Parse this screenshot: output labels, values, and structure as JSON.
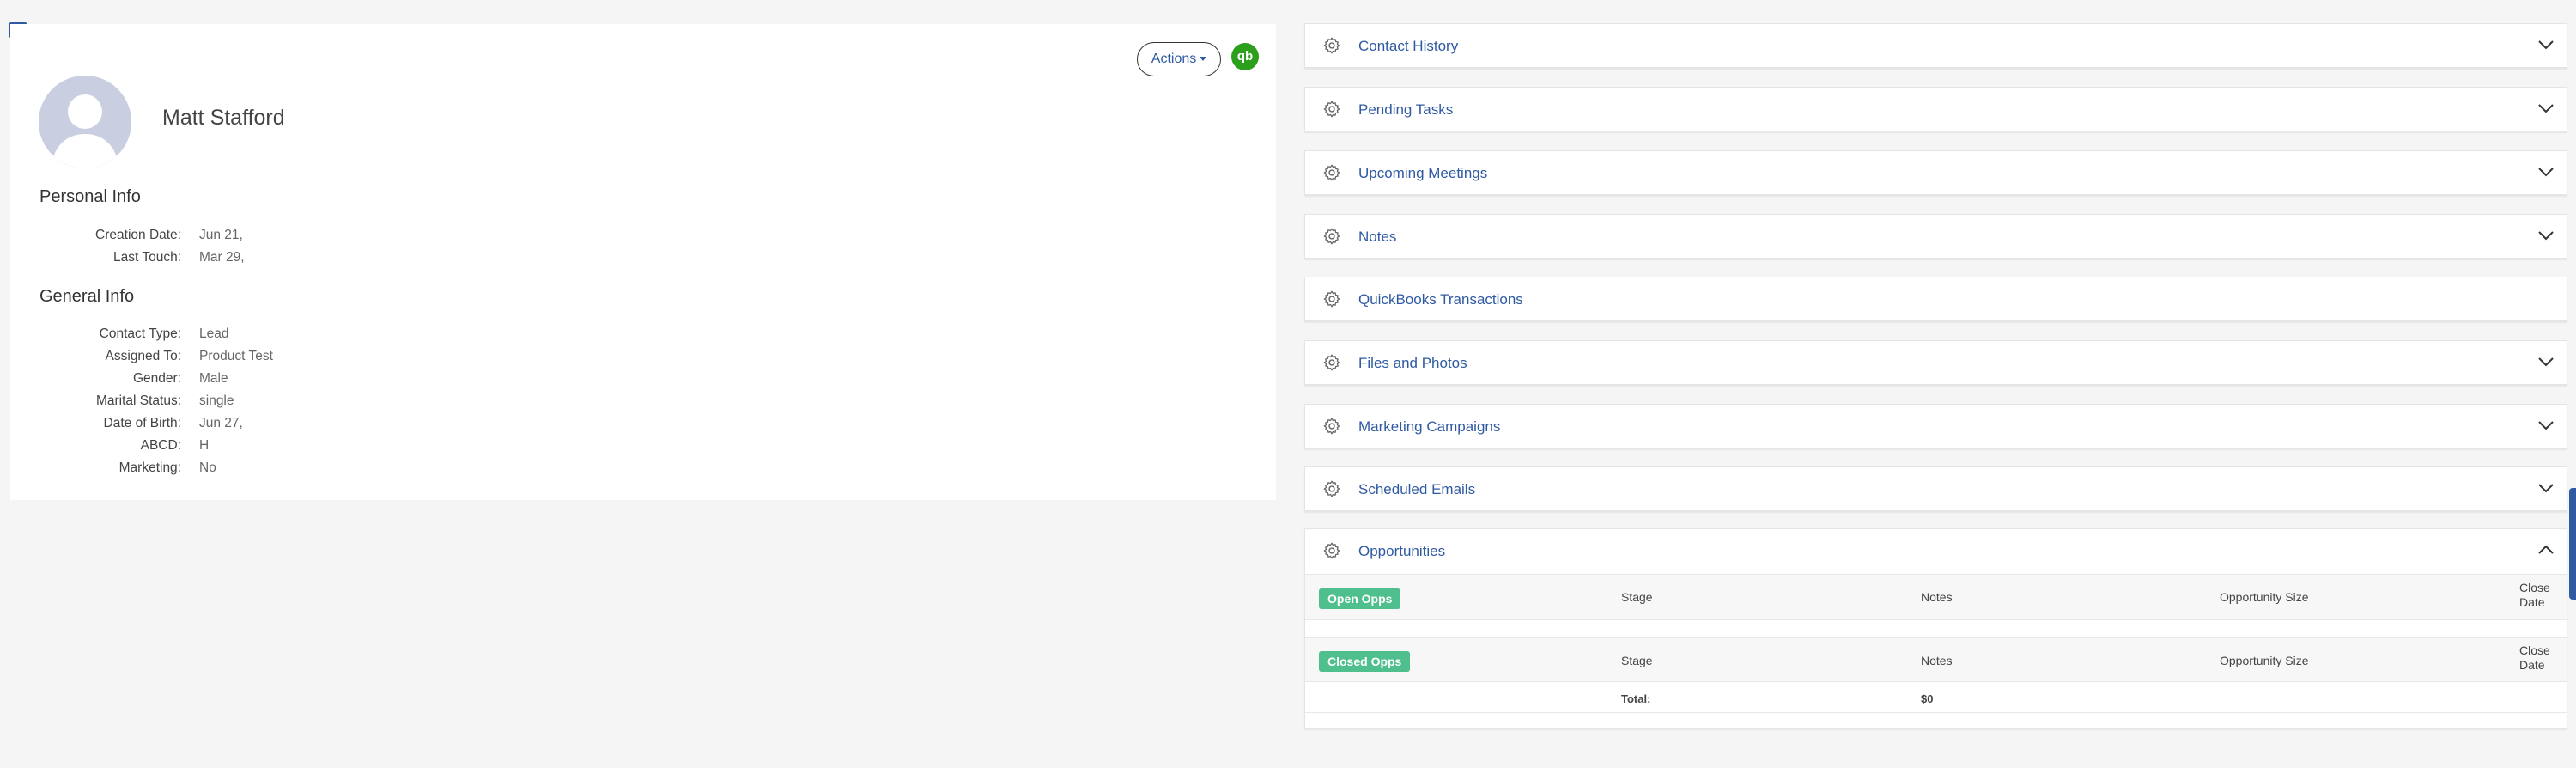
{
  "contact": {
    "name": "Matt Stafford",
    "actions_label": "Actions",
    "qb_label": "qb"
  },
  "personal_info": {
    "title": "Personal Info",
    "rows": [
      {
        "label": "Creation Date:",
        "value": "Jun 21,"
      },
      {
        "label": "Last Touch:",
        "value": "Mar 29,"
      }
    ]
  },
  "general_info": {
    "title": "General Info",
    "rows": [
      {
        "label": "Contact Type:",
        "value": "Lead"
      },
      {
        "label": "Assigned To:",
        "value": "Product Test"
      },
      {
        "label": "Gender:",
        "value": "Male"
      },
      {
        "label": "Marital Status:",
        "value": "single"
      },
      {
        "label": "Date of Birth:",
        "value": "Jun 27,"
      },
      {
        "label": "ABCD:",
        "value": "H"
      },
      {
        "label": "Marketing:",
        "value": "No"
      }
    ]
  },
  "panels": [
    {
      "title": "Contact History",
      "chevron": "down"
    },
    {
      "title": "Pending Tasks",
      "chevron": "down"
    },
    {
      "title": "Upcoming Meetings",
      "chevron": "down"
    },
    {
      "title": "Notes",
      "chevron": "down"
    },
    {
      "title": "QuickBooks Transactions",
      "chevron": "none"
    },
    {
      "title": "Files and Photos",
      "chevron": "down"
    },
    {
      "title": "Marketing Campaigns",
      "chevron": "down"
    },
    {
      "title": "Scheduled Emails",
      "chevron": "down"
    }
  ],
  "opportunities": {
    "title": "Opportunities",
    "open_badge": "Open Opps",
    "closed_badge": "Closed Opps",
    "columns": {
      "stage": "Stage",
      "notes": "Notes",
      "size": "Opportunity Size",
      "close_line1": "Close",
      "close_line2": "Date"
    },
    "total_label": "Total:",
    "total_value": "$0"
  },
  "colors": {
    "accent": "#2f5aa1",
    "badge_green": "#4fc08d",
    "qb_green": "#2ca01c"
  }
}
